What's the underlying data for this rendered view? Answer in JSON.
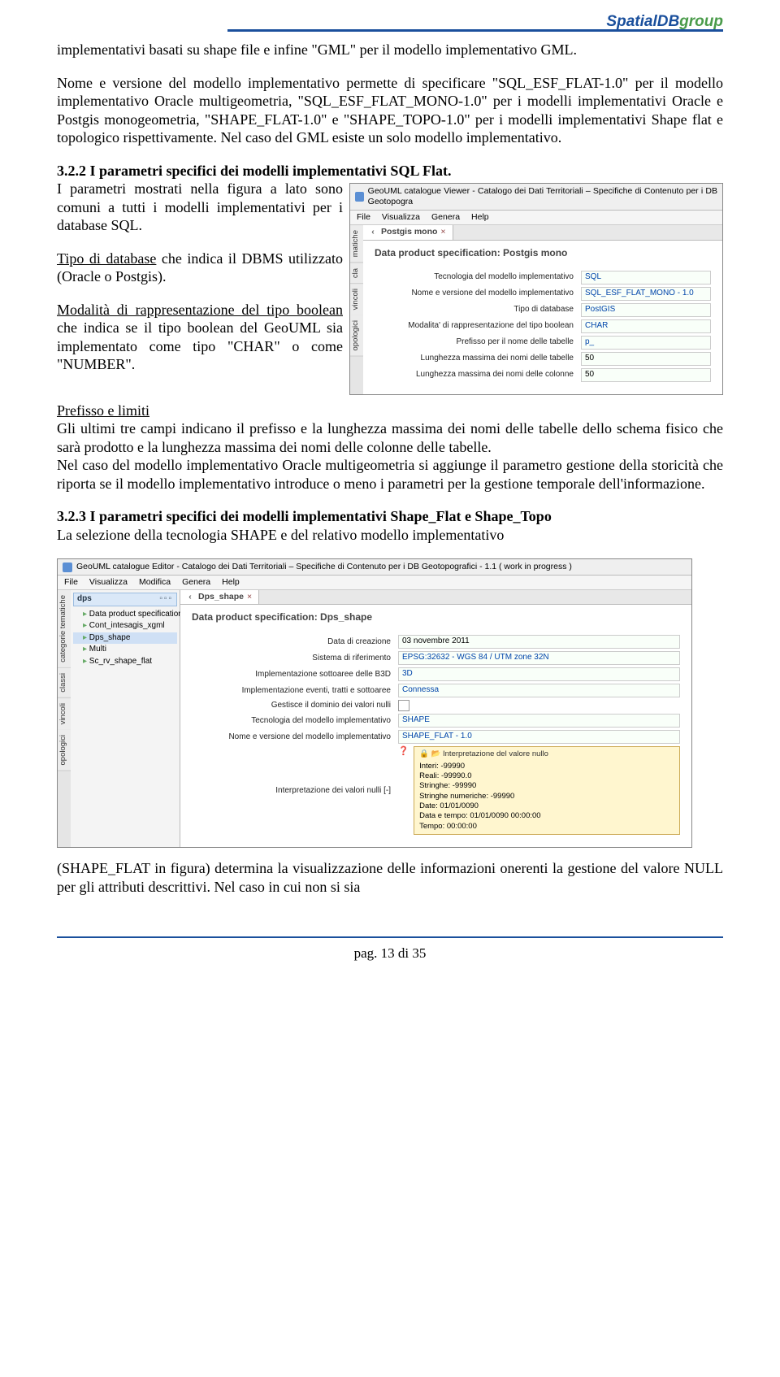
{
  "header": {
    "blue": "SpatialDB",
    "green": "group"
  },
  "para1": "implementativi basati su shape file e infine \"GML\" per il modello implementativo GML.",
  "para2": "Nome e versione del modello implementativo permette di specificare \"SQL_ESF_FLAT-1.0\" per il modello implementativo Oracle multigeometria, \"SQL_ESF_FLAT_MONO-1.0\" per i modelli implementativi Oracle e Postgis monogeometria, \"SHAPE_FLAT-1.0\" e \"SHAPE_TOPO-1.0\" per i modelli implementativi Shape flat e topologico rispettivamente. Nel caso del GML esiste un solo modello implementativo.",
  "sec322_title": "3.2.2 I parametri specifici dei modelli implementativi SQL Flat.",
  "sec322_p1": "I parametri mostrati nella figura a lato sono comuni a tutti i modelli implementativi per i database SQL.",
  "sec322_p2_a": "Tipo di database",
  "sec322_p2_b": " che indica il DBMS utilizzato (Oracle o Postgis).",
  "sec322_p3_a": "Modalità di rappresentazione del tipo boolean",
  "sec322_p3_b": " che indica se il tipo boolean del GeoUML sia implementato come tipo \"CHAR\" o come \"NUMBER\".",
  "prefissi_title": "Prefisso e limiti",
  "prefissi_body": "Gli ultimi tre campi indicano il prefisso e la lunghezza massima dei nomi delle tabelle dello schema fisico che sarà prodotto e la lunghezza massima dei nomi delle colonne delle tabelle.\nNel caso del modello implementativo Oracle multigeometria si aggiunge il parametro gestione della storicità che riporta se il modello implementativo introduce o meno i parametri per la gestione temporale dell'informazione.",
  "sec323_title": "3.2.3 I parametri specifici dei modelli implementativi Shape_Flat e Shape_Topo",
  "sec323_p1": "La selezione della tecnologia SHAPE e del relativo modello implementativo",
  "sec323_p2": "(SHAPE_FLAT in figura) determina la visualizzazione delle informazioni onerenti la gestione del valore NULL per gli attributi descrittivi. Nel caso in cui non si sia",
  "footer": "pag. 13 di 35",
  "fig1": {
    "title": "GeoUML catalogue Viewer - Catalogo dei Dati Territoriali – Specifiche di Contenuto per i DB Geotopogra",
    "menus": [
      "File",
      "Visualizza",
      "Genera",
      "Help"
    ],
    "side_tabs": [
      "matiche",
      "cla",
      "vincoli",
      "opologici"
    ],
    "tab": "Postgis mono",
    "heading": "Data product specification: Postgis mono",
    "rows": [
      {
        "label": "Tecnologia del modello implementativo",
        "val": "SQL",
        "blue": true
      },
      {
        "label": "Nome e versione del modello implementativo",
        "val": "SQL_ESF_FLAT_MONO - 1.0",
        "blue": true
      },
      {
        "label": "Tipo di database",
        "val": "PostGIS",
        "blue": true
      },
      {
        "label": "Modalita' di rappresentazione del tipo boolean",
        "val": "CHAR",
        "blue": true
      },
      {
        "label": "Prefisso per il nome delle tabelle",
        "val": "p_",
        "blue": true
      },
      {
        "label": "Lunghezza massima dei nomi delle tabelle",
        "val": "50"
      },
      {
        "label": "Lunghezza massima dei nomi delle colonne",
        "val": "50"
      }
    ]
  },
  "fig2": {
    "title": "GeoUML catalogue Editor - Catalogo dei Dati Territoriali – Specifiche di Contenuto per i DB Geotopografici - 1.1 ( work in progress )",
    "menus": [
      "File",
      "Visualizza",
      "Modifica",
      "Genera",
      "Help"
    ],
    "side_tabs": [
      "categorie tematiche",
      "classi",
      "vincoli",
      "opologici"
    ],
    "tree_header": "dps",
    "tree": [
      "Data product specification",
      "Cont_intesagis_xgml",
      "Dps_shape",
      "Multi",
      "Sc_rv_shape_flat"
    ],
    "tree_sel_index": 2,
    "tab": "Dps_shape",
    "heading": "Data product specification: Dps_shape",
    "rows": [
      {
        "label": "Data di creazione",
        "val": "03 novembre 2011"
      },
      {
        "label": "Sistema di riferimento",
        "val": "EPSG:32632 - WGS 84 / UTM zone 32N",
        "blue": true
      },
      {
        "label": "Implementazione sottoaree delle B3D",
        "val": "3D",
        "blue": true
      },
      {
        "label": "Implementazione eventi, tratti e sottoaree",
        "val": "Connessa",
        "blue": true
      },
      {
        "label": "Gestisce il dominio dei valori nulli",
        "val": "__checkbox__"
      },
      {
        "label": "Tecnologia del modello implementativo",
        "val": "SHAPE",
        "blue": true
      },
      {
        "label": "Nome e versione del modello implementativo",
        "val": "SHAPE_FLAT - 1.0",
        "blue": true
      },
      {
        "label": "Interpretazione dei valori nulli [-]",
        "val": "__nullbox__"
      }
    ],
    "nullbox": {
      "hh": "Interpretazione del valore nullo",
      "lines": [
        "Interi: -99990",
        "Reali: -99990.0",
        "Stringhe: -99990",
        "Stringhe numeriche: -99990",
        "Date: 01/01/0090",
        "Data e tempo: 01/01/0090 00:00:00",
        "Tempo: 00:00:00"
      ]
    }
  }
}
